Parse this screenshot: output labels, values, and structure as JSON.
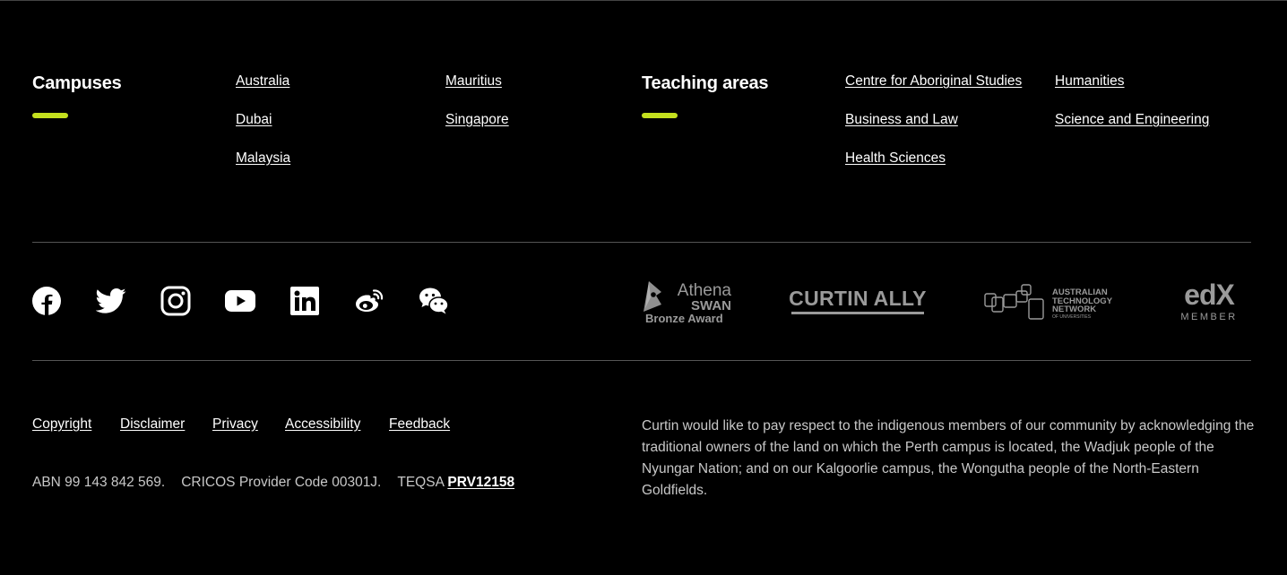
{
  "campuses": {
    "title": "Campuses",
    "links": [
      "Australia",
      "Dubai",
      "Malaysia",
      "Mauritius",
      "Singapore"
    ]
  },
  "teaching": {
    "title": "Teaching areas",
    "links": [
      "Centre for Aboriginal Studies",
      "Business and Law",
      "Health Sciences",
      "Humanities",
      "Science and Engineering"
    ]
  },
  "social": {
    "icons": [
      "facebook-icon",
      "twitter-icon",
      "instagram-icon",
      "youtube-icon",
      "linkedin-icon",
      "weibo-icon",
      "wechat-icon"
    ]
  },
  "badges": {
    "athena_line1": "Athena",
    "athena_line2": "SWAN",
    "athena_line3": "Bronze Award",
    "curtin_ally": "CURTIN ALLY",
    "atn_line1": "AUSTRALIAN",
    "atn_line2": "TECHNOLOGY",
    "atn_line3": "NETWORK",
    "atn_line4": "OF UNIVERSITIES",
    "edx": "edX",
    "edx_member": "MEMBER"
  },
  "legal": {
    "links": [
      "Copyright",
      "Disclaimer",
      "Privacy",
      "Accessibility",
      "Feedback"
    ],
    "abn": "ABN 99 143 842 569.",
    "cricos": "CRICOS Provider Code 00301J.",
    "teqsa_label": "TEQSA",
    "teqsa_code": "PRV12158"
  },
  "acknowledgement": "Curtin would like to pay respect to the indigenous members of our community by acknowledging the traditional owners of the land on which the Perth campus is located, the Wadjuk people of the Nyungar Nation; and on our Kalgoorlie campus, the Wongutha people of the North-Eastern Goldfields.",
  "colors": {
    "background": "#000000",
    "accent": "#c4e01e",
    "text": "#ffffff",
    "muted_text": "#c8c8c8",
    "logo_grey": "#9a9a9a"
  }
}
